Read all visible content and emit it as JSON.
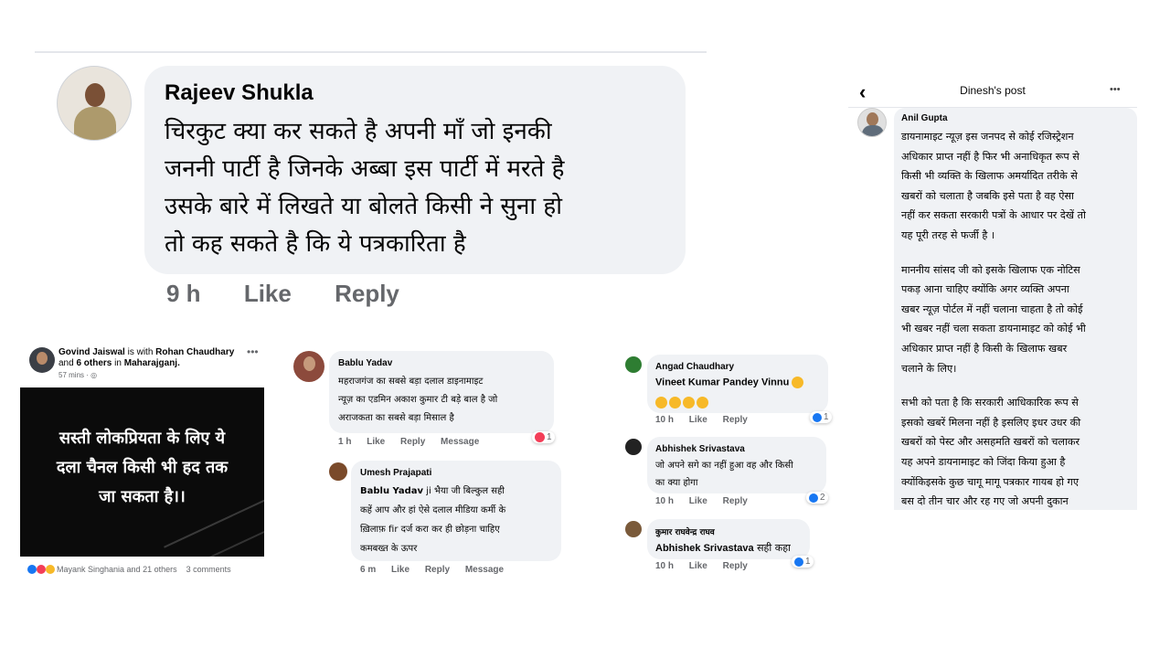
{
  "colors": {
    "bubble": "#f0f2f5",
    "link": "#1877f2",
    "meta": "#65676b",
    "black_panel": "#0b0b0b"
  },
  "panel_a": {
    "author": "Rajeev Shukla",
    "lines": [
      "चिरकुट क्या कर सकते है अपनी माँ जो इनकी",
      "जननी पार्टी है जिनके अब्बा इस पार्टी में मरते है",
      "उसके बारे में लिखते या बोलते किसी ने सुना हो",
      "तो कह सकते है कि ये पत्रकारिता है"
    ],
    "time": "9 h",
    "like": "Like",
    "reply": "Reply"
  },
  "panel_b": {
    "author": "Govind Jaiswal",
    "with_text": "is with",
    "with_name": "Rohan Chaudhary",
    "and_text": "and",
    "others": "6 others",
    "in_text": "in",
    "place": "Maharajganj.",
    "time": "57 mins ·",
    "image_lines": [
      "सस्ती लोकप्रियता के लिए ये",
      "दला चैनल किसी भी हद तक",
      "जा सकता है।।"
    ],
    "reactions_text": "Mayank Singhania and 21 others",
    "comments": "3 comments"
  },
  "panel_c": {
    "c1": {
      "author": "Bablu Yadav",
      "lines": [
        "महराजगंज का सबसे बड़ा दलाल डाइनामाइट",
        "न्यूज़ का एडमिन अकाश कुमार टी बड़े बाल है जो",
        "अराजकता का सबसे बड़ा मिसाल है"
      ],
      "time": "1 h",
      "like": "Like",
      "reply": "Reply",
      "message": "Message",
      "reaction_count": "1"
    },
    "c2": {
      "author": "Umesh Prajapati",
      "tag": "Bablu Yadav",
      "first_line_rest": " ji भैया जी बिल्कुल सही",
      "lines": [
        "कहें आप और हां ऐसे दलाल मीडिया कर्मी के",
        "ख़िलाफ़ fir दर्ज करा कर ही छोड़ना चाहिए",
        "कमबख्त के ऊपर"
      ],
      "time": "6 m",
      "like": "Like",
      "reply": "Reply",
      "message": "Message"
    }
  },
  "panel_d": {
    "c1": {
      "author": "Angad Chaudhary",
      "tag": "Vineet Kumar Pandey Vinnu",
      "time": "10 h",
      "like": "Like",
      "reply": "Reply",
      "reaction_count": "1"
    },
    "c2": {
      "author": "Abhishek Srivastava",
      "lines": [
        "जो अपने सगे का नहीं हुआ वह और किसी",
        "का क्या होगा"
      ],
      "time": "10 h",
      "like": "Like",
      "reply": "Reply",
      "reaction_count": "2"
    },
    "c3": {
      "author": "कुमार राघवेन्द्र राघव",
      "tag": "Abhishek Srivastava",
      "rest": " सही कहा",
      "time": "10 h",
      "like": "Like",
      "reply": "Reply",
      "reaction_count": "1"
    }
  },
  "panel_e": {
    "title": "Dinesh's post",
    "more": "•••",
    "author": "Anil Gupta",
    "para1": [
      "डायनामाइट न्यूज़ इस जनपद से कोई रजिस्ट्रेशन",
      "अधिकार प्राप्त नहीं है फिर भी अनाधिकृत रूप से",
      "किसी भी व्यक्ति के खिलाफ अमर्यादित तरीके से",
      "खबरों को चलाता है जबकि इसे पता है वह ऐसा",
      "नहीं कर सकता सरकारी पत्रों के आधार पर देखें तो",
      "यह पूरी तरह से फर्जी है ।"
    ],
    "para2": [
      "माननीय सांसद जी को इसके खिलाफ एक नोटिस",
      "पकड़ आना चाहिए क्योंकि अगर व्यक्ति अपना",
      "खबर न्यूज़ पोर्टल में नहीं चलाना चाहता है तो कोई",
      "भी खबर नहीं चला सकता डायनामाइट को कोई भी",
      "अधिकार प्राप्त नहीं है किसी के खिलाफ खबर",
      "चलाने के लिए।"
    ],
    "para3": [
      "सभी को पता है कि सरकारी आधिकारिक रूप से",
      "इसको खबरें मिलना नहीं है इसलिए इधर उधर की",
      "खबरों को पेस्ट और असहमति खबरों को चलाकर",
      "यह अपने डायनामाइट को जिंदा किया हुआ है",
      "क्योंकिइसके  कुछ चागू मागू पत्रकार गायब हो गए",
      "बस दो तीन चार और रह गए जो अपनी दुकान"
    ]
  }
}
